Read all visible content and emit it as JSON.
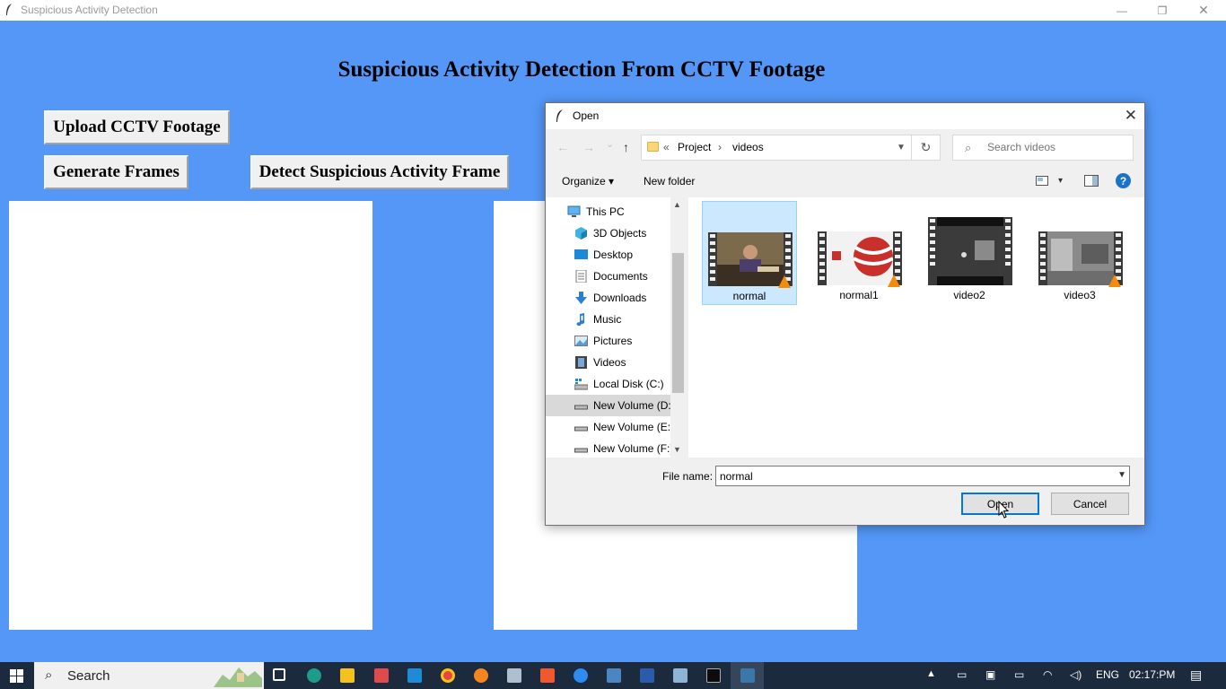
{
  "window": {
    "title": "Suspicious Activity Detection",
    "controls": {
      "minimize": "—",
      "maximize": "❐",
      "close": "✕"
    }
  },
  "app": {
    "heading": "Suspicious Activity Detection From CCTV Footage",
    "buttons": {
      "upload": "Upload CCTV Footage",
      "generate": "Generate Frames",
      "detect": "Detect Suspicious Activity Frame"
    }
  },
  "dialog": {
    "title": "Open",
    "close": "✕",
    "nav": {
      "back": "←",
      "forward": "→",
      "recent": "⌄",
      "up": "↑"
    },
    "path": {
      "overflow": "«",
      "segments": [
        "Project",
        "videos"
      ],
      "separator": "›"
    },
    "refresh": "↻",
    "search_placeholder": "Search videos",
    "toolbar": {
      "organize": "Organize ▾",
      "new_folder": "New folder",
      "view_dd": "▾",
      "help": "?"
    },
    "nav_items": [
      {
        "label": "This PC",
        "icon": "this-pc-icon"
      },
      {
        "label": "3D Objects",
        "icon": "3d-objects-icon"
      },
      {
        "label": "Desktop",
        "icon": "desktop-icon"
      },
      {
        "label": "Documents",
        "icon": "documents-icon"
      },
      {
        "label": "Downloads",
        "icon": "downloads-icon"
      },
      {
        "label": "Music",
        "icon": "music-icon"
      },
      {
        "label": "Pictures",
        "icon": "pictures-icon"
      },
      {
        "label": "Videos",
        "icon": "videos-icon"
      },
      {
        "label": "Local Disk (C:)",
        "icon": "local-disk-icon"
      },
      {
        "label": "New Volume (D:",
        "icon": "drive-icon"
      },
      {
        "label": "New Volume (E:)",
        "icon": "drive-icon"
      },
      {
        "label": "New Volume (F:)",
        "icon": "drive-icon"
      }
    ],
    "files": [
      {
        "name": "normal",
        "selected": true
      },
      {
        "name": "normal1",
        "selected": false
      },
      {
        "name": "video2",
        "selected": false
      },
      {
        "name": "video3",
        "selected": false
      }
    ],
    "file_name_label": "File name:",
    "file_name_value": "normal",
    "open_button": "Open",
    "cancel_button": "Cancel"
  },
  "taskbar": {
    "search_label": "Search",
    "language": "ENG",
    "time": "02:17:PM"
  },
  "colors": {
    "background": "#5497f6",
    "selection": "#cce8ff",
    "accent": "#0078d7",
    "taskbar": "#1c2a3d"
  }
}
